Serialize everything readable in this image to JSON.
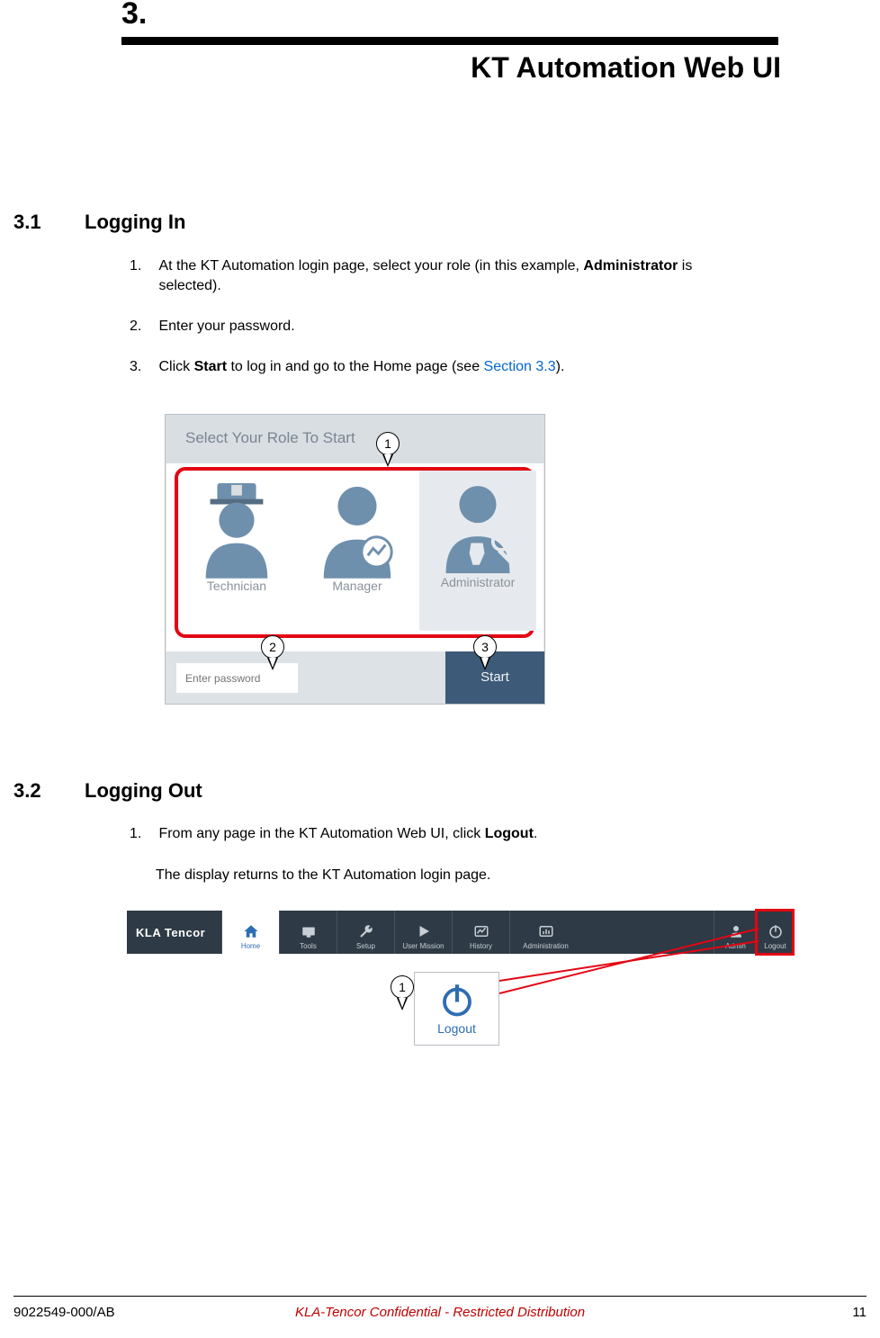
{
  "chapter": {
    "num": "3.",
    "title": "KT Automation Web UI"
  },
  "sections": {
    "s31": {
      "num": "3.1",
      "title": "Logging In",
      "step1_num": "1.",
      "step1_a": "At the KT Automation login page, select your role (in this example, ",
      "step1_bold": "Administrator",
      "step1_b": " is selected).",
      "step2_num": "2.",
      "step2": "Enter your password.",
      "step3_num": "3.",
      "step3_a": "Click ",
      "step3_bold": "Start",
      "step3_b": " to log in and go to the Home page (see ",
      "step3_link": "Section 3.3",
      "step3_c": ")."
    },
    "s32": {
      "num": "3.2",
      "title": "Logging Out",
      "step1_num": "1.",
      "step1_a": "From any page in the KT Automation Web UI, click ",
      "step1_bold": "Logout",
      "step1_b": ".",
      "step1_after": "The display returns to the KT Automation login page."
    }
  },
  "login": {
    "header": "Select Your Role To Start",
    "roles": [
      "Technician",
      "Manager",
      "Administrator"
    ],
    "password_placeholder": "Enter password",
    "start": "Start"
  },
  "callouts": {
    "c1": "1",
    "c2": "2",
    "c3": "3",
    "c4": "1"
  },
  "nav": {
    "logo": "KLA Tencor",
    "items": [
      "Home",
      "Tools",
      "Setup",
      "User Mission",
      "History",
      "Administration"
    ],
    "right": [
      "Admin",
      "Logout"
    ]
  },
  "logout_enlarged": "Logout",
  "footer": {
    "left": "9022549-000/AB",
    "center": "KLA-Tencor Confidential - Restricted Distribution",
    "right": "11"
  }
}
